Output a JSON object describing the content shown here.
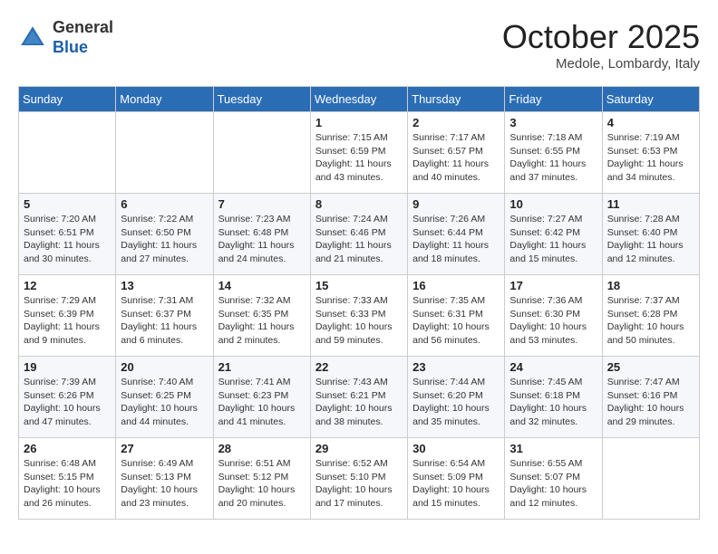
{
  "header": {
    "logo_line1": "General",
    "logo_line2": "Blue",
    "month_title": "October 2025",
    "location": "Medole, Lombardy, Italy"
  },
  "days_of_week": [
    "Sunday",
    "Monday",
    "Tuesday",
    "Wednesday",
    "Thursday",
    "Friday",
    "Saturday"
  ],
  "weeks": [
    [
      {
        "day": "",
        "info": ""
      },
      {
        "day": "",
        "info": ""
      },
      {
        "day": "",
        "info": ""
      },
      {
        "day": "1",
        "info": "Sunrise: 7:15 AM\nSunset: 6:59 PM\nDaylight: 11 hours and 43 minutes."
      },
      {
        "day": "2",
        "info": "Sunrise: 7:17 AM\nSunset: 6:57 PM\nDaylight: 11 hours and 40 minutes."
      },
      {
        "day": "3",
        "info": "Sunrise: 7:18 AM\nSunset: 6:55 PM\nDaylight: 11 hours and 37 minutes."
      },
      {
        "day": "4",
        "info": "Sunrise: 7:19 AM\nSunset: 6:53 PM\nDaylight: 11 hours and 34 minutes."
      }
    ],
    [
      {
        "day": "5",
        "info": "Sunrise: 7:20 AM\nSunset: 6:51 PM\nDaylight: 11 hours and 30 minutes."
      },
      {
        "day": "6",
        "info": "Sunrise: 7:22 AM\nSunset: 6:50 PM\nDaylight: 11 hours and 27 minutes."
      },
      {
        "day": "7",
        "info": "Sunrise: 7:23 AM\nSunset: 6:48 PM\nDaylight: 11 hours and 24 minutes."
      },
      {
        "day": "8",
        "info": "Sunrise: 7:24 AM\nSunset: 6:46 PM\nDaylight: 11 hours and 21 minutes."
      },
      {
        "day": "9",
        "info": "Sunrise: 7:26 AM\nSunset: 6:44 PM\nDaylight: 11 hours and 18 minutes."
      },
      {
        "day": "10",
        "info": "Sunrise: 7:27 AM\nSunset: 6:42 PM\nDaylight: 11 hours and 15 minutes."
      },
      {
        "day": "11",
        "info": "Sunrise: 7:28 AM\nSunset: 6:40 PM\nDaylight: 11 hours and 12 minutes."
      }
    ],
    [
      {
        "day": "12",
        "info": "Sunrise: 7:29 AM\nSunset: 6:39 PM\nDaylight: 11 hours and 9 minutes."
      },
      {
        "day": "13",
        "info": "Sunrise: 7:31 AM\nSunset: 6:37 PM\nDaylight: 11 hours and 6 minutes."
      },
      {
        "day": "14",
        "info": "Sunrise: 7:32 AM\nSunset: 6:35 PM\nDaylight: 11 hours and 2 minutes."
      },
      {
        "day": "15",
        "info": "Sunrise: 7:33 AM\nSunset: 6:33 PM\nDaylight: 10 hours and 59 minutes."
      },
      {
        "day": "16",
        "info": "Sunrise: 7:35 AM\nSunset: 6:31 PM\nDaylight: 10 hours and 56 minutes."
      },
      {
        "day": "17",
        "info": "Sunrise: 7:36 AM\nSunset: 6:30 PM\nDaylight: 10 hours and 53 minutes."
      },
      {
        "day": "18",
        "info": "Sunrise: 7:37 AM\nSunset: 6:28 PM\nDaylight: 10 hours and 50 minutes."
      }
    ],
    [
      {
        "day": "19",
        "info": "Sunrise: 7:39 AM\nSunset: 6:26 PM\nDaylight: 10 hours and 47 minutes."
      },
      {
        "day": "20",
        "info": "Sunrise: 7:40 AM\nSunset: 6:25 PM\nDaylight: 10 hours and 44 minutes."
      },
      {
        "day": "21",
        "info": "Sunrise: 7:41 AM\nSunset: 6:23 PM\nDaylight: 10 hours and 41 minutes."
      },
      {
        "day": "22",
        "info": "Sunrise: 7:43 AM\nSunset: 6:21 PM\nDaylight: 10 hours and 38 minutes."
      },
      {
        "day": "23",
        "info": "Sunrise: 7:44 AM\nSunset: 6:20 PM\nDaylight: 10 hours and 35 minutes."
      },
      {
        "day": "24",
        "info": "Sunrise: 7:45 AM\nSunset: 6:18 PM\nDaylight: 10 hours and 32 minutes."
      },
      {
        "day": "25",
        "info": "Sunrise: 7:47 AM\nSunset: 6:16 PM\nDaylight: 10 hours and 29 minutes."
      }
    ],
    [
      {
        "day": "26",
        "info": "Sunrise: 6:48 AM\nSunset: 5:15 PM\nDaylight: 10 hours and 26 minutes."
      },
      {
        "day": "27",
        "info": "Sunrise: 6:49 AM\nSunset: 5:13 PM\nDaylight: 10 hours and 23 minutes."
      },
      {
        "day": "28",
        "info": "Sunrise: 6:51 AM\nSunset: 5:12 PM\nDaylight: 10 hours and 20 minutes."
      },
      {
        "day": "29",
        "info": "Sunrise: 6:52 AM\nSunset: 5:10 PM\nDaylight: 10 hours and 17 minutes."
      },
      {
        "day": "30",
        "info": "Sunrise: 6:54 AM\nSunset: 5:09 PM\nDaylight: 10 hours and 15 minutes."
      },
      {
        "day": "31",
        "info": "Sunrise: 6:55 AM\nSunset: 5:07 PM\nDaylight: 10 hours and 12 minutes."
      },
      {
        "day": "",
        "info": ""
      }
    ]
  ]
}
